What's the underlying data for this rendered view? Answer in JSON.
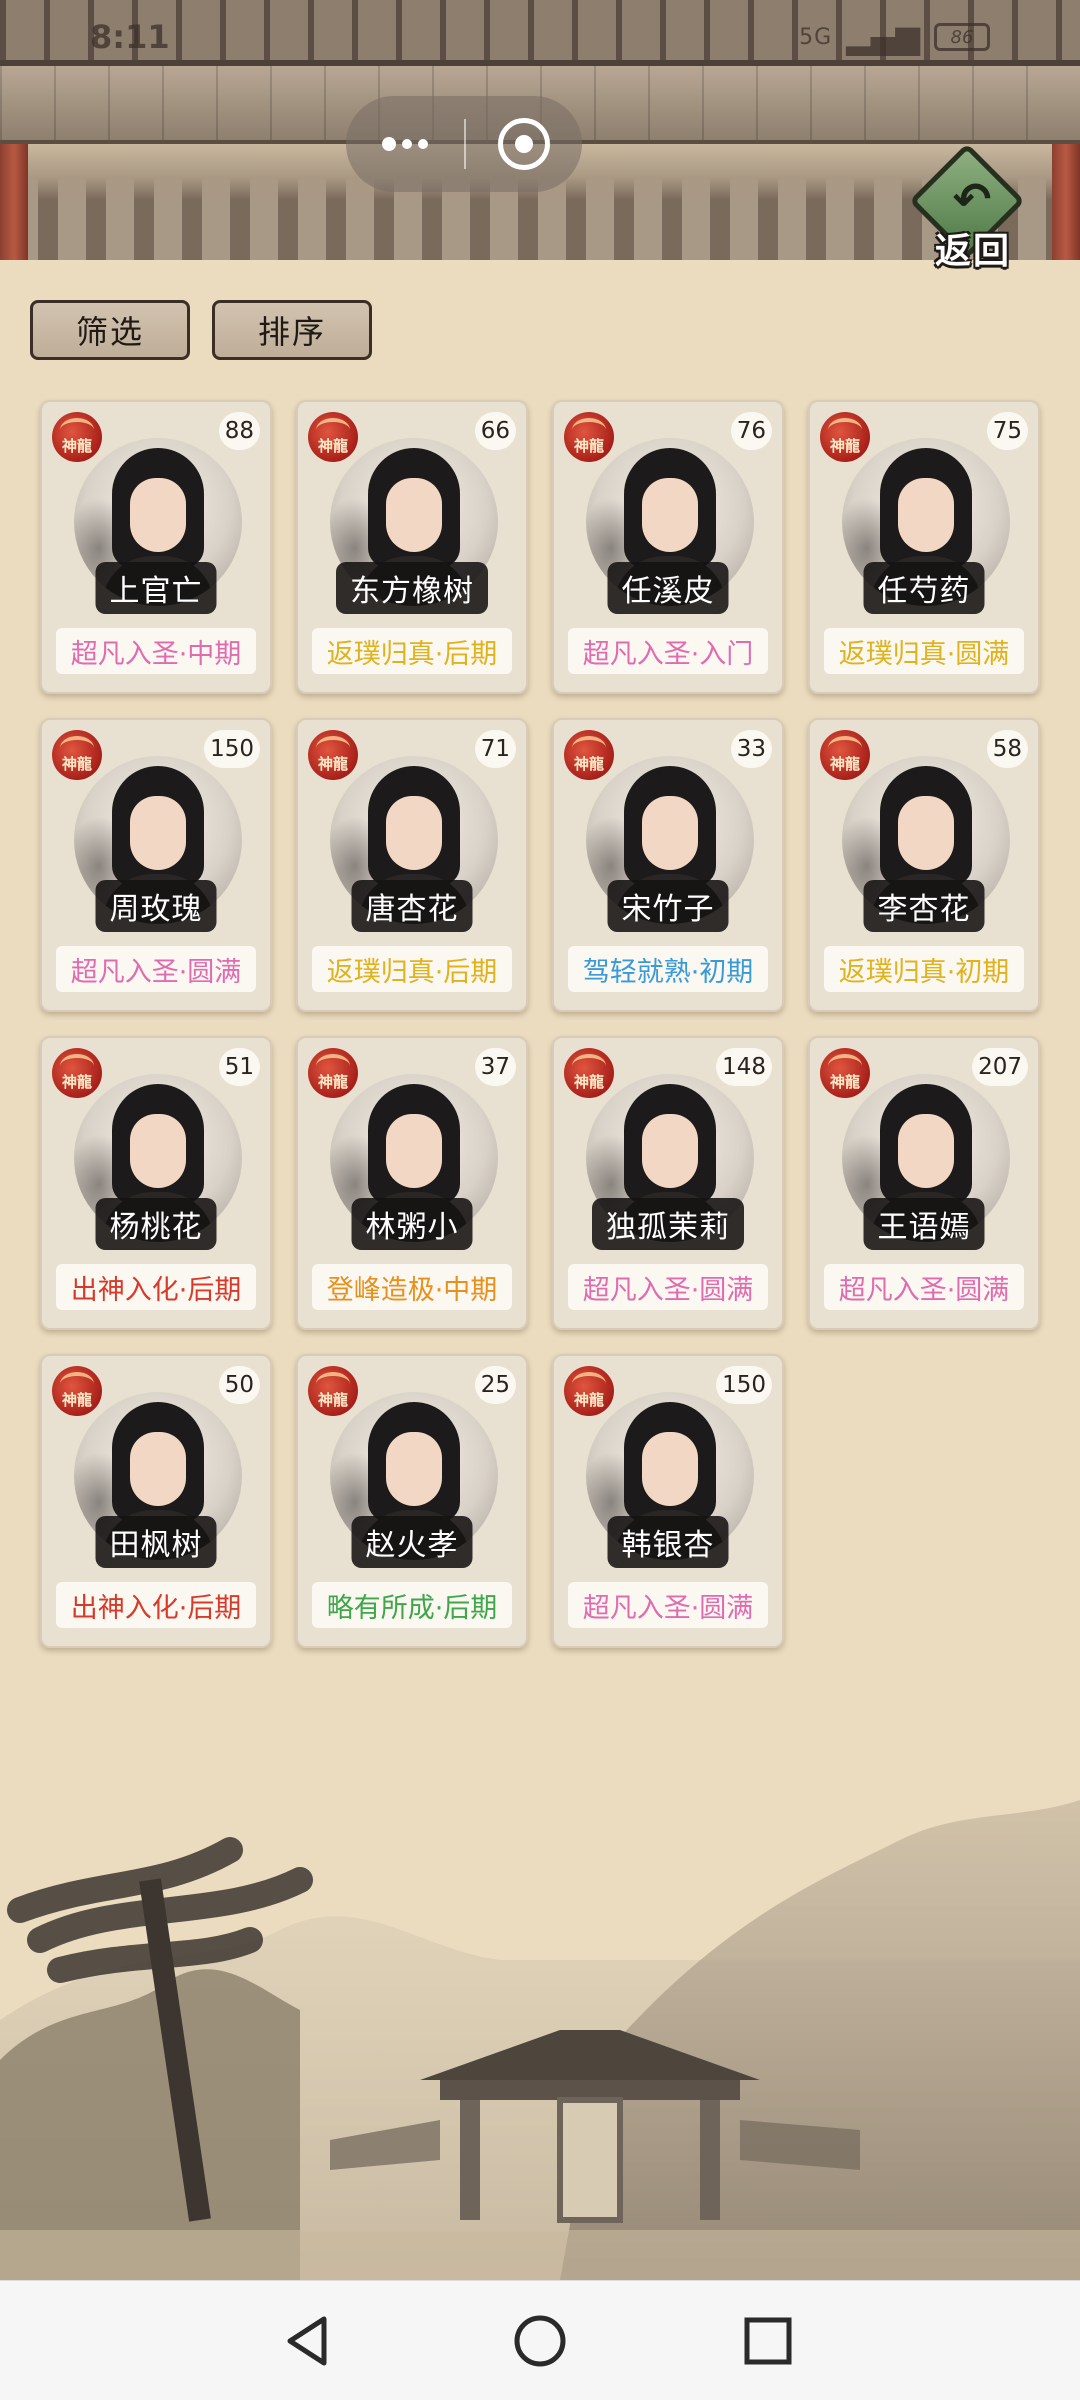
{
  "status": {
    "time": "8:11",
    "network": "5G",
    "battery": "86"
  },
  "back_button": {
    "label": "返回"
  },
  "toolbar": {
    "filter_label": "筛选",
    "sort_label": "排序"
  },
  "badge_text": "神龍",
  "colors": {
    "pink": "#e06cb0",
    "yellow": "#e0b21e",
    "blue": "#3a9ad8",
    "red": "#d83a2a",
    "orange": "#e8901c",
    "green": "#3fa64a"
  },
  "characters": [
    {
      "name": "上官亡",
      "level": "88",
      "realm": "超凡入圣·中期",
      "color": "#e06cb0"
    },
    {
      "name": "东方橡树",
      "level": "66",
      "realm": "返璞归真·后期",
      "color": "#e0b21e"
    },
    {
      "name": "任溪皮",
      "level": "76",
      "realm": "超凡入圣·入门",
      "color": "#e06cb0"
    },
    {
      "name": "任芍药",
      "level": "75",
      "realm": "返璞归真·圆满",
      "color": "#e0b21e"
    },
    {
      "name": "周玫瑰",
      "level": "150",
      "realm": "超凡入圣·圆满",
      "color": "#e06cb0"
    },
    {
      "name": "唐杏花",
      "level": "71",
      "realm": "返璞归真·后期",
      "color": "#e0b21e"
    },
    {
      "name": "宋竹子",
      "level": "33",
      "realm": "驾轻就熟·初期",
      "color": "#3a9ad8"
    },
    {
      "name": "李杏花",
      "level": "58",
      "realm": "返璞归真·初期",
      "color": "#e0b21e"
    },
    {
      "name": "杨桃花",
      "level": "51",
      "realm": "出神入化·后期",
      "color": "#d83a2a"
    },
    {
      "name": "林粥小",
      "level": "37",
      "realm": "登峰造极·中期",
      "color": "#e8901c"
    },
    {
      "name": "独孤茉莉",
      "level": "148",
      "realm": "超凡入圣·圆满",
      "color": "#e06cb0"
    },
    {
      "name": "王语嫣",
      "level": "207",
      "realm": "超凡入圣·圆满",
      "color": "#e06cb0"
    },
    {
      "name": "田枫树",
      "level": "50",
      "realm": "出神入化·后期",
      "color": "#d83a2a"
    },
    {
      "name": "赵火孝",
      "level": "25",
      "realm": "略有所成·后期",
      "color": "#3fa64a"
    },
    {
      "name": "韩银杏",
      "level": "150",
      "realm": "超凡入圣·圆满",
      "color": "#e06cb0"
    }
  ]
}
